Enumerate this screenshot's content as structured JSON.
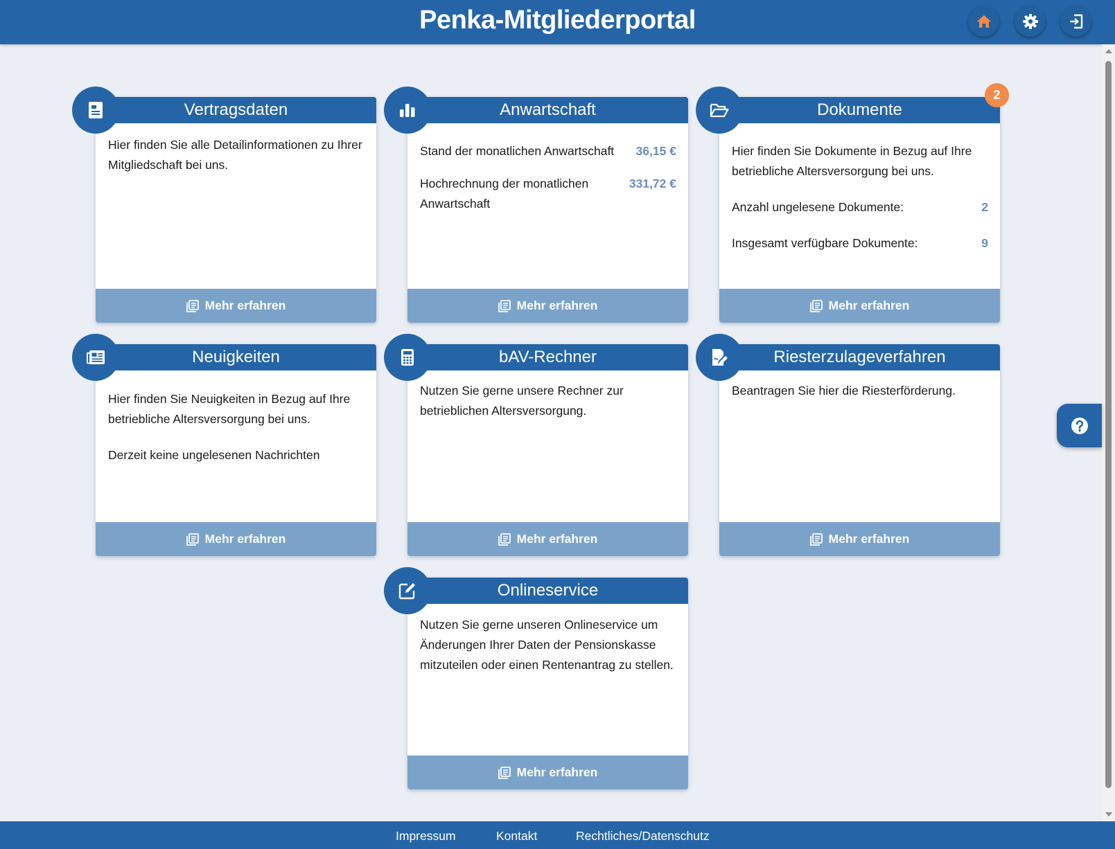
{
  "header": {
    "title": "Penka-Mitgliederportal",
    "buttons": [
      {
        "name": "home",
        "icon": "home-icon",
        "color": "#f28a4a"
      },
      {
        "name": "settings",
        "icon": "gear-icon",
        "color": "#ffffff"
      },
      {
        "name": "logout",
        "icon": "logout-icon",
        "color": "#ffffff"
      }
    ]
  },
  "cards": {
    "vertragsdaten": {
      "title": "Vertragsdaten",
      "icon": "contract-icon",
      "text": "Hier finden Sie alle Detailinformationen zu Ihrer Mitgliedschaft bei uns.",
      "link": "Mehr erfahren"
    },
    "anwartschaft": {
      "title": "Anwartschaft",
      "icon": "bar-chart-icon",
      "rows": [
        {
          "label": "Stand der monatlichen Anwartschaft",
          "value": "36,15 €"
        },
        {
          "label": "Hochrechnung der monatlichen Anwartschaft",
          "value": "331,72 €"
        }
      ],
      "link": "Mehr erfahren"
    },
    "dokumente": {
      "title": "Dokumente",
      "icon": "folder-open-icon",
      "badge": "2",
      "text": "Hier finden Sie Dokumente in Bezug auf Ihre betriebliche Altersversorgung bei uns.",
      "rows": [
        {
          "label": "Anzahl ungelesene Dokumente:",
          "value": "2"
        },
        {
          "label": "Insgesamt verfügbare Dokumente:",
          "value": "9"
        }
      ],
      "link": "Mehr erfahren"
    },
    "neuigkeiten": {
      "title": "Neuigkeiten",
      "icon": "newspaper-icon",
      "text": "Hier finden Sie Neuigkeiten in Bezug auf Ihre betriebliche Altersversorgung bei uns.",
      "text2": "Derzeit keine ungelesenen Nachrichten",
      "link": "Mehr erfahren"
    },
    "rechner": {
      "title": "bAV-Rechner",
      "icon": "calculator-icon",
      "text": "Nutzen Sie gerne unsere Rechner zur betrieblichen Altersversorgung.",
      "link": "Mehr erfahren"
    },
    "riester": {
      "title": "Riesterzulageverfahren",
      "icon": "signature-icon",
      "text": "Beantragen Sie hier die Riesterförderung.",
      "link": "Mehr erfahren"
    },
    "onlineservice": {
      "title": "Onlineservice",
      "icon": "edit-icon",
      "text": "Nutzen Sie gerne unseren Onlineservice um Änderungen Ihrer Daten der Pensionskasse mitzuteilen oder einen Rentenantrag zu stellen.",
      "link": "Mehr erfahren"
    }
  },
  "help": {
    "icon": "question-icon"
  },
  "footer": {
    "links": [
      "Impressum",
      "Kontakt",
      "Rechtliches/Datenschutz"
    ]
  },
  "colors": {
    "primary": "#2565a7",
    "footer_button": "#7ba3ca",
    "accent": "#f28a4a",
    "value": "#6b8db5",
    "background": "#ebeef4"
  }
}
